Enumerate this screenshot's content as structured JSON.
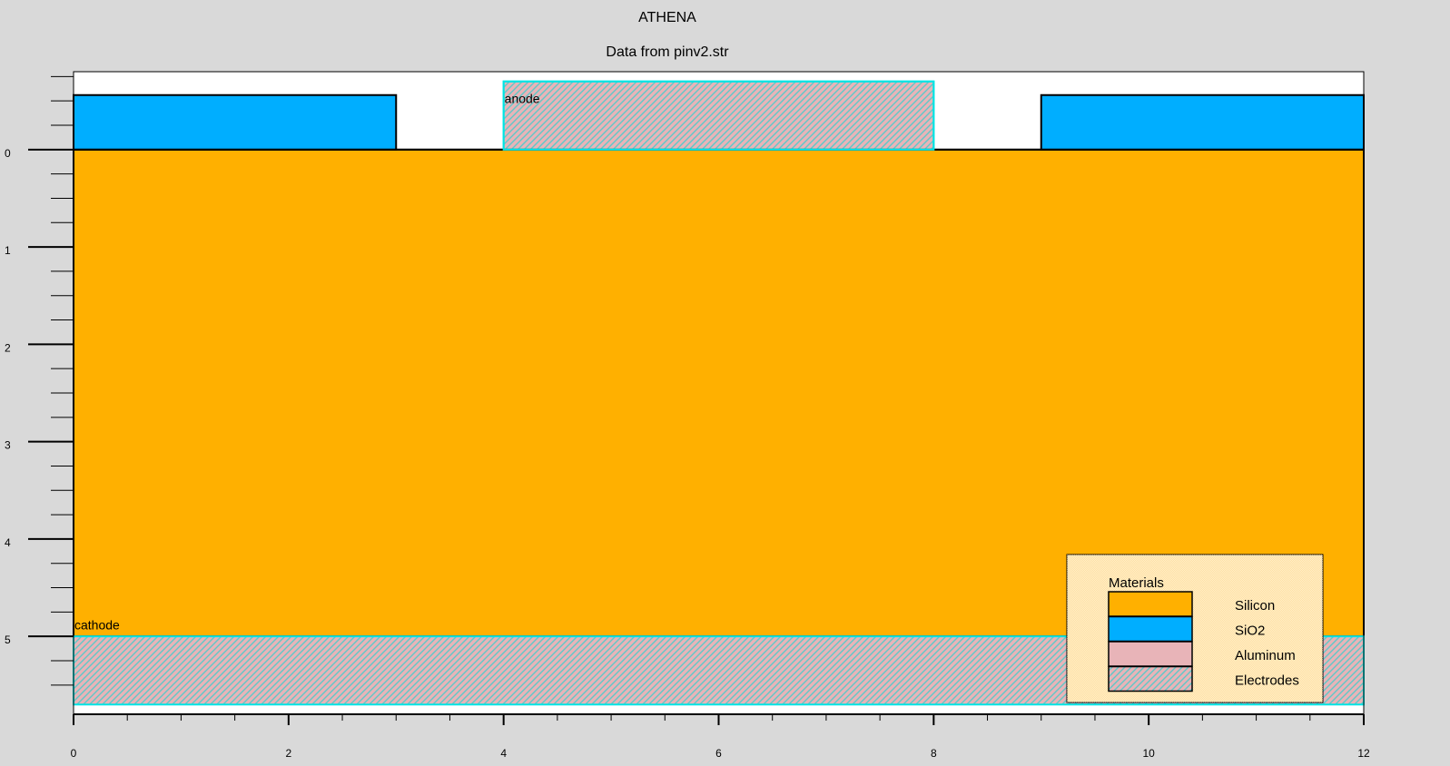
{
  "title": "ATHENA",
  "subtitle": "Data from pinv2.str",
  "colors": {
    "silicon": "#ffb000",
    "sio2": "#00aeff",
    "aluminum": "#e8b4b8",
    "electrode_hatch": "#5ec8c8",
    "electrode_border": "#00e5e5",
    "background": "#d9d9d9",
    "plot_bg": "#ffffff"
  },
  "chart_data": {
    "type": "cross-section",
    "xlim": [
      0,
      12
    ],
    "ylim": [
      -0.8,
      5.8
    ],
    "x_tick_labels": [
      "0",
      "2",
      "4",
      "6",
      "8",
      "10",
      "12"
    ],
    "x_tick_values": [
      0,
      2,
      4,
      6,
      8,
      10,
      12
    ],
    "y_tick_labels": [
      "0",
      "1",
      "2",
      "3",
      "4",
      "5"
    ],
    "y_tick_values": [
      0,
      1,
      2,
      3,
      4,
      5
    ],
    "regions": [
      {
        "name": "silicon",
        "material": "Silicon",
        "x": [
          0,
          12
        ],
        "y": [
          0,
          5
        ]
      },
      {
        "name": "oxide-left",
        "material": "SiO2",
        "x": [
          0,
          3
        ],
        "y": [
          -0.56,
          0
        ]
      },
      {
        "name": "oxide-right",
        "material": "SiO2",
        "x": [
          9,
          12
        ],
        "y": [
          -0.56,
          0
        ]
      },
      {
        "name": "anode",
        "material": "Electrodes",
        "x": [
          4,
          8
        ],
        "y": [
          -0.7,
          0
        ]
      },
      {
        "name": "cathode",
        "material": "Electrodes",
        "x": [
          0,
          12
        ],
        "y": [
          5,
          5.7
        ]
      }
    ],
    "labels": [
      {
        "text": "anode",
        "x": 4.0,
        "y": -0.48
      },
      {
        "text": "cathode",
        "x": 0.0,
        "y": 4.93
      }
    ],
    "legend": {
      "title": "Materials",
      "position": "bottom-right",
      "entries": [
        {
          "label": "Silicon",
          "swatch": "silicon"
        },
        {
          "label": "SiO2",
          "swatch": "sio2"
        },
        {
          "label": "Aluminum",
          "swatch": "aluminum"
        },
        {
          "label": "Electrodes",
          "swatch": "hatch"
        }
      ]
    }
  }
}
